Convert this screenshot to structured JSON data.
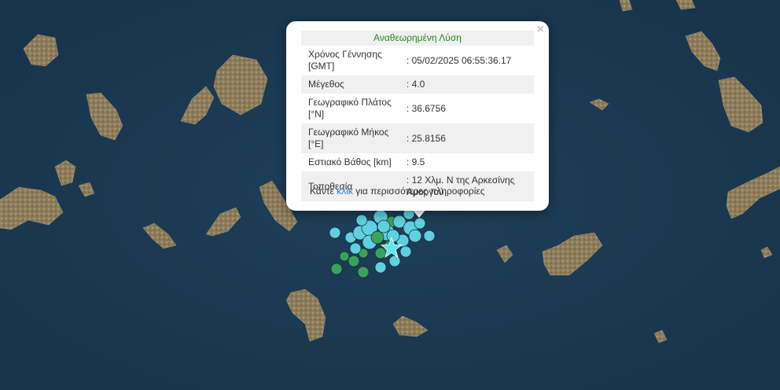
{
  "popup": {
    "title": "Αναθεωρημένη Λύση",
    "close": "×",
    "rows": [
      {
        "label": "Χρόνος Γέννησης [GMT]",
        "value": ": 05/02/2025 06:55:36.17"
      },
      {
        "label": "Μέγεθος",
        "value": ": 4.0"
      },
      {
        "label": "Γεωγραφικό Πλάτος [°N]",
        "value": ": 36.6756"
      },
      {
        "label": "Γεωγραφικό Μήκος [°E]",
        "value": ": 25.8156"
      },
      {
        "label": "Εστιακό Βάθος [km]",
        "value": ": 9.5"
      },
      {
        "label": "Τοποθεσία",
        "value": ": 12 Χλμ. Ν της Αρκεσίνης Αμοργού"
      }
    ],
    "footer": {
      "before": "Κάντε ",
      "link": "κλικ",
      "after": " για περισσότερες πληροφορίες"
    }
  },
  "map": {
    "sea_color": "#1c3a52",
    "land_color": "#8a7a5a",
    "event_color_recent": "#5fd0e0",
    "event_color_older": "#3aa35a",
    "selected_event_icon": "star-icon"
  }
}
